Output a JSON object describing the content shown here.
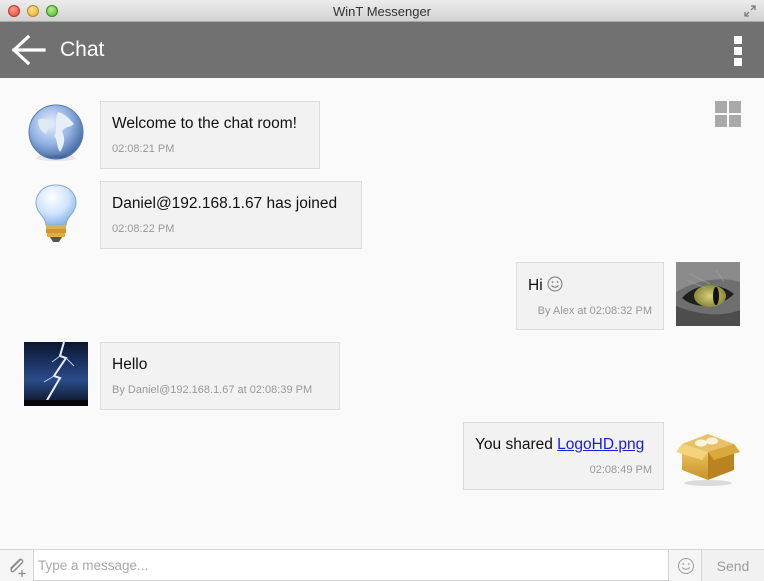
{
  "window": {
    "title": "WinT Messenger"
  },
  "appbar": {
    "title": "Chat",
    "back_icon": "arrow-left-icon",
    "menu_icon": "overflow-menu-icon"
  },
  "messages": [
    {
      "side": "left",
      "avatar": "globe-icon",
      "text": "Welcome to the chat room!",
      "meta": "02:08:21 PM"
    },
    {
      "side": "left",
      "avatar": "lightbulb-icon",
      "text": "Daniel@192.168.1.67 has joined",
      "meta": "02:08:22 PM"
    },
    {
      "side": "right",
      "avatar": "cat-eye-avatar",
      "text": "Hi",
      "emoji": "smiley-icon",
      "meta": "By Alex at 02:08:32 PM"
    },
    {
      "side": "left",
      "avatar": "lightning-avatar",
      "text": "Hello",
      "meta": "By Daniel@192.168.1.67 at 02:08:39 PM"
    },
    {
      "side": "right",
      "avatar": "package-box-icon",
      "text_prefix": "You shared",
      "link": "LogoHD.png",
      "meta": "02:08:49 PM"
    }
  ],
  "input": {
    "placeholder": "Type a message...",
    "value": ""
  },
  "send_label": "Send"
}
